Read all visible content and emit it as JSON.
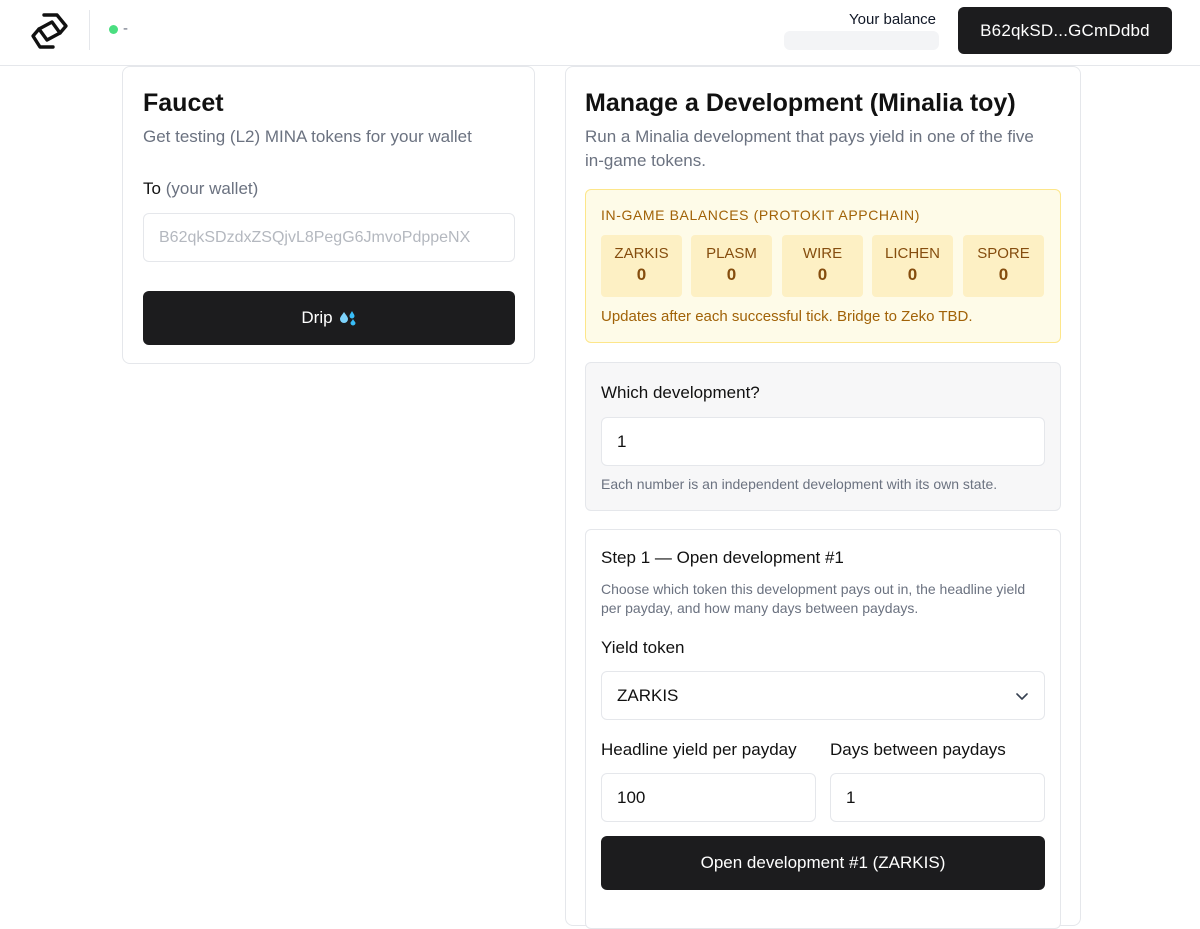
{
  "header": {
    "logo_icon": "hexagon-link-logo",
    "status_text": "-",
    "status_color": "#4ade80",
    "balance_label": "Your balance",
    "wallet_button_label": "B62qkSD...GCmDdbd"
  },
  "faucet": {
    "title": "Faucet",
    "subtitle": "Get testing (L2) MINA tokens for your wallet",
    "to_label": "To",
    "to_hint": "(your wallet)",
    "address_placeholder": "B62qkSDzdxZSQjvL8PegG6JmvoPdppeNX",
    "drip_label": "Drip",
    "drip_icon": "water-droplets-icon"
  },
  "development": {
    "title": "Manage a Development (Minalia toy)",
    "subtitle": "Run a Minalia development that pays yield in one of the five in-game tokens.",
    "balances": {
      "title": "IN-GAME BALANCES (PROTOKIT APPCHAIN)",
      "tokens": [
        {
          "name": "ZARKIS",
          "value": "0"
        },
        {
          "name": "PLASM",
          "value": "0"
        },
        {
          "name": "WIRE",
          "value": "0"
        },
        {
          "name": "LICHEN",
          "value": "0"
        },
        {
          "name": "SPORE",
          "value": "0"
        }
      ],
      "note": "Updates after each successful tick. Bridge to Zeko TBD.",
      "accent_color": "#a16207"
    },
    "which": {
      "label": "Which development?",
      "value": "1",
      "help": "Each number is an independent development with its own state."
    },
    "step1": {
      "title": "Step 1 — Open development #1",
      "description": "Choose which token this development pays out in, the headline yield per payday, and how many days between paydays.",
      "yield_token_label": "Yield token",
      "yield_token_value": "ZARKIS",
      "headline_yield_label": "Headline yield per payday",
      "headline_yield_value": "100",
      "days_label": "Days between paydays",
      "days_value": "1",
      "open_button_label": "Open development #1 (ZARKIS)"
    }
  }
}
